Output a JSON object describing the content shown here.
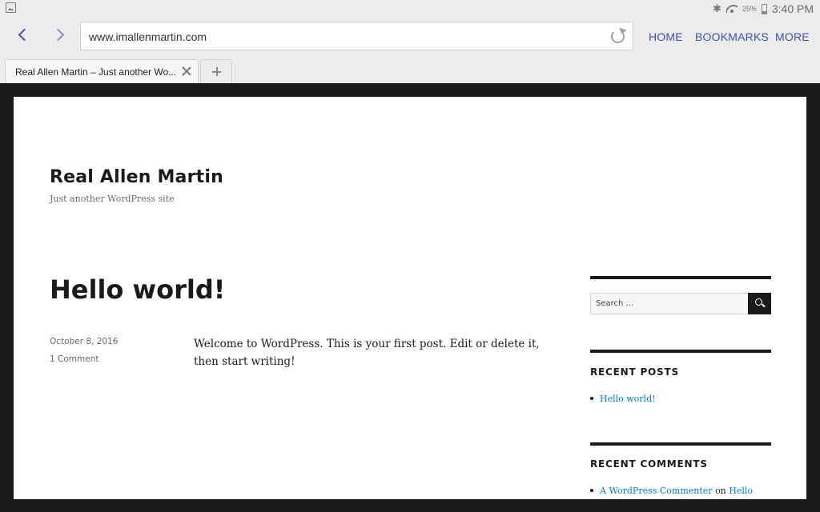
{
  "status": {
    "battery": "25%",
    "time": "3:40 PM"
  },
  "toolbar": {
    "url": "www.imallenmartin.com",
    "home": "HOME",
    "bookmarks": "BOOKMARKS",
    "more": "MORE"
  },
  "tabs": [
    {
      "title": "Real Allen Martin – Just another Wo..."
    }
  ],
  "site": {
    "title": "Real Allen Martin",
    "description": "Just another WordPress site"
  },
  "post": {
    "title": "Hello world!",
    "date": "October 8, 2016",
    "comments": "1 Comment",
    "body": "Welcome to WordPress. This is your first post. Edit or delete it, then start writing!"
  },
  "sidebar": {
    "search_placeholder": "Search …",
    "recent_posts_title": "RECENT POSTS",
    "recent_posts": [
      "Hello world!"
    ],
    "recent_comments_title": "RECENT COMMENTS",
    "recent_comment": {
      "author": "A WordPress Commenter",
      "on": "on",
      "post": "Hello"
    }
  },
  "colors": {
    "accent": "#3f51b5",
    "link": "#007acc",
    "text": "#1a1a1a"
  }
}
